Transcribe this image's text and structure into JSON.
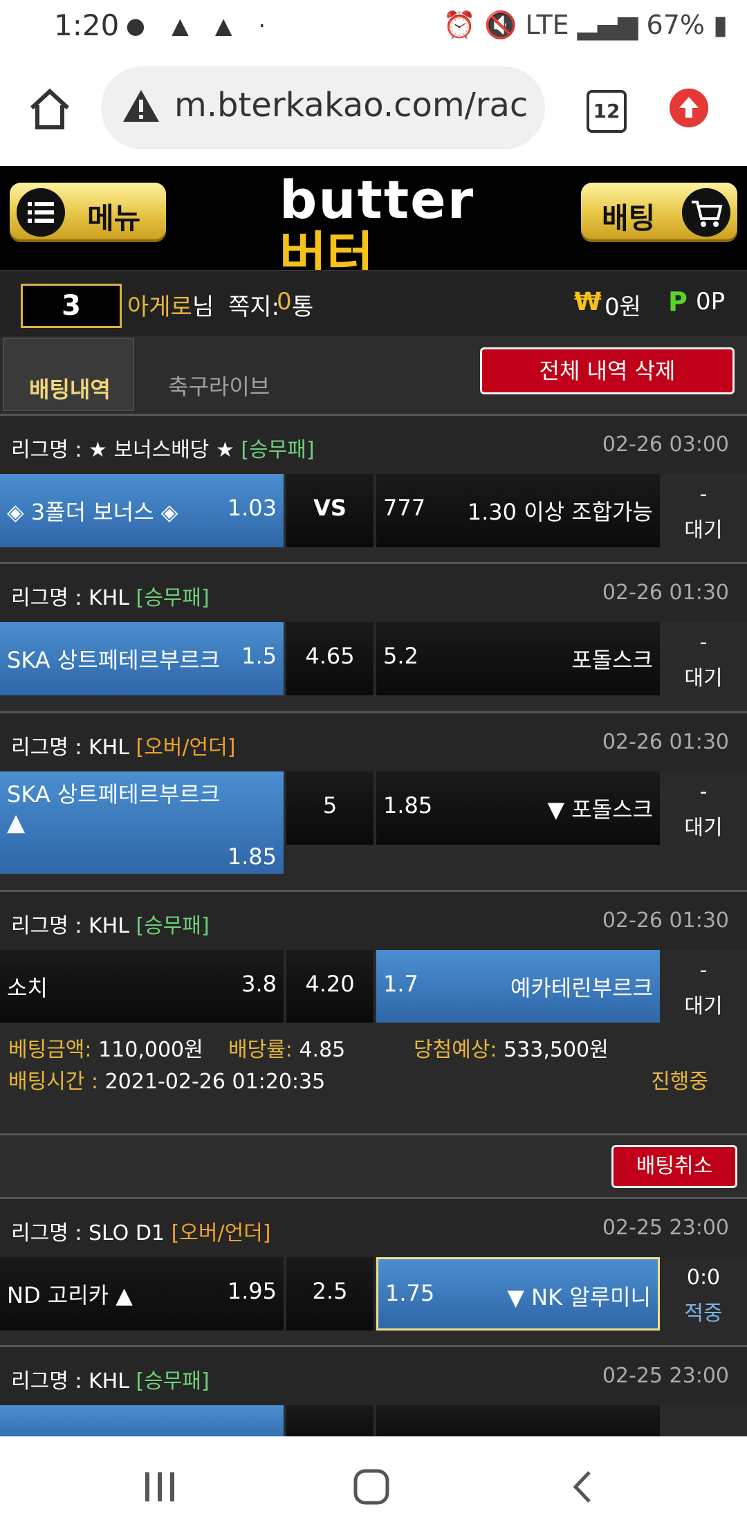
{
  "status_bar": {
    "time": "1:20",
    "battery": "67%",
    "network": "LTE"
  },
  "browser": {
    "url": "m.bterkakao.com/rac",
    "tab_count": "12"
  },
  "header": {
    "menu_label": "메뉴",
    "bet_label": "배팅",
    "logo_en": "butter",
    "logo_ko": "버터"
  },
  "user": {
    "level": "3",
    "name": "아게로",
    "suffix": "님",
    "note_label": "쪽지:",
    "note_count": "0",
    "note_unit": "통",
    "won_icon": "₩",
    "money": "0원",
    "point_icon": "P",
    "points": "0P"
  },
  "tabs": {
    "history": "배팅내역",
    "live": "축구라이브",
    "delete_all": "전체 내역 삭제"
  },
  "bets": [
    {
      "league": "리그명 : ★ 보너스배당 ★",
      "type": "[승무패]",
      "time": "02-26 03:00",
      "home": "◈ 3폴더 보너스 ◈",
      "home_odds": "1.03",
      "mid": "VS",
      "away_odds": "777",
      "away": "1.30 이상 조합가능",
      "status_top": "-",
      "status_bot": "대기"
    },
    {
      "league": "리그명 : KHL",
      "type": "[승무패]",
      "time": "02-26 01:30",
      "home": "SKA 상트페테르부르크",
      "home_odds": "1.5",
      "mid": "4.65",
      "away_odds": "5.2",
      "away": "포돌스크",
      "status_top": "-",
      "status_bot": "대기"
    },
    {
      "league": "리그명 : KHL",
      "type": "[오버/언더]",
      "time": "02-26 01:30",
      "home": "SKA 상트페테르부르크",
      "home_arrow": "▲",
      "home_odds": "1.85",
      "mid": "5",
      "away_odds": "1.85",
      "away": "▼ 포돌스크",
      "status_top": "-",
      "status_bot": "대기"
    },
    {
      "league": "리그명 : KHL",
      "type": "[승무패]",
      "time": "02-26 01:30",
      "home": "소치",
      "home_odds": "3.8",
      "mid": "4.20",
      "away_odds": "1.7",
      "away": "예카테린부르크",
      "status_top": "-",
      "status_bot": "대기"
    }
  ],
  "bet_summary": {
    "amount_label": "베팅금액:",
    "amount": "110,000원",
    "rate_label": "배당률:",
    "rate": "4.85",
    "expected_label": "당첨예상:",
    "expected": "533,500원",
    "time_label": "배팅시간 :",
    "time": "2021-02-26 01:20:35",
    "progress": "진행중"
  },
  "cancel_label": "배팅취소",
  "bets2": [
    {
      "league": "리그명 : SLO D1",
      "type": "[오버/언더]",
      "time": "02-25 23:00",
      "home": "ND 고리카 ▲",
      "home_odds": "1.95",
      "mid": "2.5",
      "away_odds": "1.75",
      "away": "▼ NK 알루미니",
      "status_top": "0:0",
      "status_bot": "적중"
    },
    {
      "league": "리그명 : KHL",
      "type": "[승무패]",
      "time": "02-25 23:00"
    }
  ],
  "colors": {
    "accent_gold": "#f6c11a",
    "selected_blue": "#3d7cc0",
    "danger_red": "#c00018",
    "win_type_green": "#6fd17a",
    "ou_type_orange": "#f0a22a",
    "hit_blue": "#7ab4e8"
  }
}
